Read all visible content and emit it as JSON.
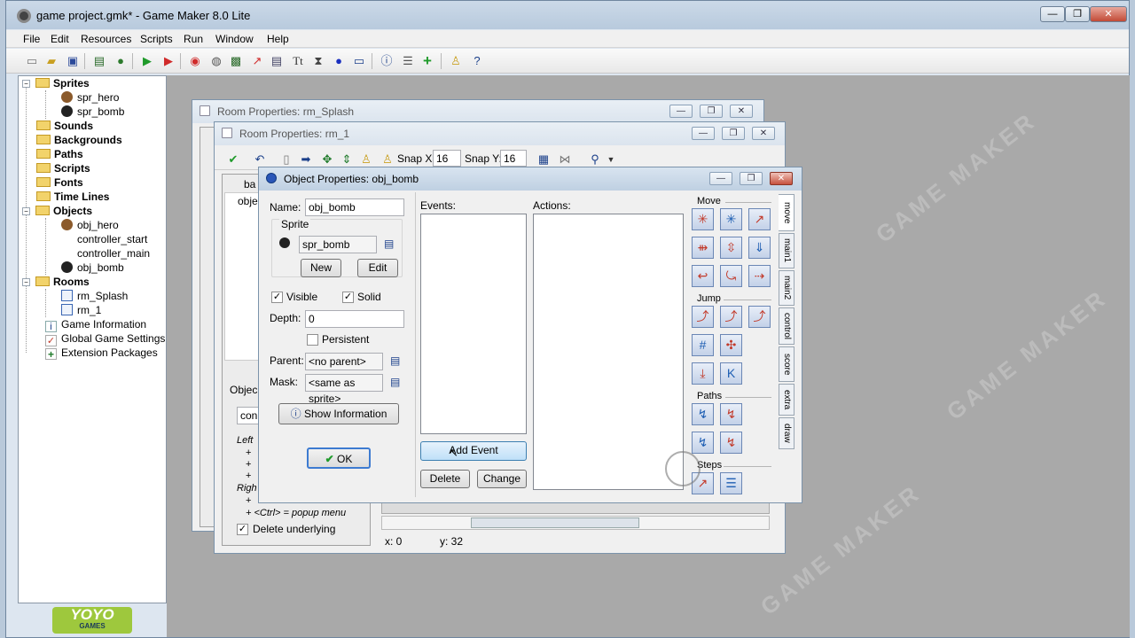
{
  "window": {
    "title": "game project.gmk* - Game Maker 8.0 Lite",
    "minimize": "—",
    "restore": "❐",
    "close": "✕"
  },
  "menu": [
    "File",
    "Edit",
    "Resources",
    "Scripts",
    "Run",
    "Window",
    "Help"
  ],
  "tree": {
    "sprites": "Sprites",
    "spr_hero": "spr_hero",
    "spr_bomb": "spr_bomb",
    "sounds": "Sounds",
    "backgrounds": "Backgrounds",
    "paths": "Paths",
    "scripts": "Scripts",
    "fonts": "Fonts",
    "time_lines": "Time Lines",
    "objects": "Objects",
    "obj_hero": "obj_hero",
    "controller_start": "controller_start",
    "controller_main": "controller_main",
    "obj_bomb": "obj_bomb",
    "rooms": "Rooms",
    "rm_splash": "rm_Splash",
    "rm_1": "rm_1",
    "game_information": "Game Information",
    "global_game_settings": "Global Game Settings",
    "extension_packages": "Extension Packages"
  },
  "room_splash": {
    "title": "Room Properties: rm_Splash"
  },
  "room1": {
    "title": "Room Properties: rm_1",
    "snap_x_label": "Snap X:",
    "snap_x": "16",
    "snap_y_label": "Snap Y:",
    "snap_y": "16",
    "tab_partial": "ba",
    "obj_partial": "obje",
    "objects_partial": "Objec",
    "field_partial": "con",
    "left_text": "Left",
    "right_text": "Righ",
    "plus1": "+",
    "plus2": "+",
    "plus3": "+",
    "plus4": "+",
    "ctrl_text": "+ <Ctrl> = popup menu",
    "delete_underlying": "Delete underlying",
    "x_coord": "x: 0",
    "y_coord": "y: 32"
  },
  "obj": {
    "title": "Object Properties: obj_bomb",
    "name_label": "Name:",
    "name_value": "obj_bomb",
    "sprite_label": "Sprite",
    "sprite_value": "spr_bomb",
    "new_button": "New",
    "edit_button": "Edit",
    "visible_label": "Visible",
    "solid_label": "Solid",
    "depth_label": "Depth:",
    "depth_value": "0",
    "persistent_label": "Persistent",
    "parent_label": "Parent:",
    "parent_value": "<no parent>",
    "mask_label": "Mask:",
    "mask_value": "<same as sprite>",
    "show_info_button": "Show Information",
    "ok_button": "OK",
    "events_label": "Events:",
    "actions_label": "Actions:",
    "add_event_button": "Add Event",
    "delete_button": "Delete",
    "change_button": "Change",
    "visible_checked": true,
    "solid_checked": true,
    "persistent_checked": false
  },
  "actions_panel": {
    "move_section": "Move",
    "jump_section": "Jump",
    "paths_section": "Paths",
    "steps_section": "Steps",
    "tabs": [
      "move",
      "main1",
      "main2",
      "control",
      "score",
      "extra",
      "draw"
    ]
  },
  "watermark": "GAME MAKER",
  "colors": {
    "title_bar": "#cbd9e8",
    "mdi_background": "#a9a9a9",
    "action_red": "#c23a2a",
    "action_blue": "#1f5fb3"
  }
}
